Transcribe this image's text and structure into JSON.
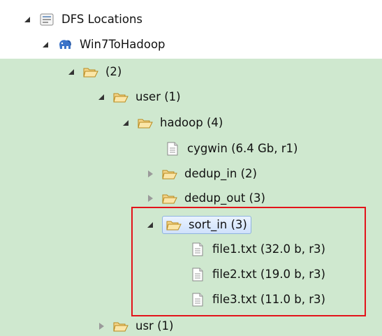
{
  "tree": {
    "root_label": "DFS Locations",
    "connection_label": "Win7ToHadoop",
    "folder_root_label": "(2)",
    "user_label": "user (1)",
    "hadoop_label": "hadoop (4)",
    "cygwin_label": "cygwin (6.4 Gb, r1)",
    "dedup_in_label": "dedup_in (2)",
    "dedup_out_label": "dedup_out (3)",
    "sort_in_label": "sort_in (3)",
    "file1_label": "file1.txt (32.0 b, r3)",
    "file2_label": "file2.txt (19.0 b, r3)",
    "file3_label": "file3.txt (11.0 b, r3)",
    "usr_label": "usr (1)"
  },
  "colors": {
    "background": "#cfe8cf",
    "highlight_border": "#e3131a",
    "folder_fill": "#f4d489"
  },
  "icons": {
    "root": "dfs-locations-icon",
    "connection": "elephant-icon",
    "folder": "folder-open-icon",
    "file": "file-icon"
  }
}
